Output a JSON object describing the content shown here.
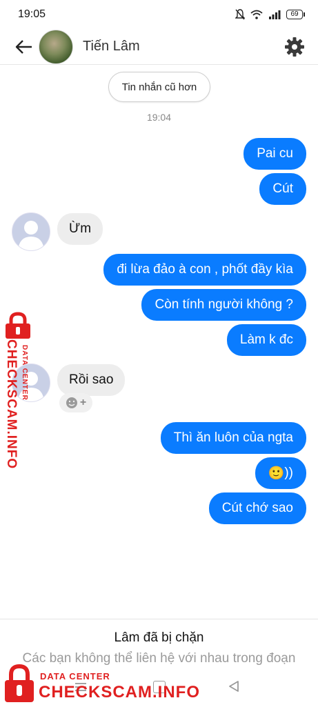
{
  "status_bar": {
    "time": "19:05",
    "battery": "69"
  },
  "header": {
    "contact_name": "Tiến Lâm"
  },
  "older_messages_label": "Tin nhắn cũ hơn",
  "timestamp": "19:04",
  "messages": [
    {
      "from": "me",
      "text": "Pai cu"
    },
    {
      "from": "me",
      "text": "Cút"
    },
    {
      "from": "them",
      "text": "Ừm"
    },
    {
      "from": "me",
      "text": "đi lừa đảo à con , phốt đầy kìa"
    },
    {
      "from": "me",
      "text": "Còn tính người không ?"
    },
    {
      "from": "me",
      "text": "Làm k đc"
    },
    {
      "from": "them",
      "text": "Rồi sao"
    },
    {
      "from": "me",
      "text": "Thì ăn luôn của ngta"
    },
    {
      "from": "me",
      "text": "))",
      "emoji": "🙂"
    },
    {
      "from": "me",
      "text": "Cút chớ sao"
    }
  ],
  "blocked": {
    "title": "Lâm đã bị chặn",
    "description": "Các bạn không thể liên hệ với nhau trong đoạn"
  },
  "watermark": {
    "small": "DATA CENTER",
    "big": "CHECKSCAM.INFO"
  },
  "colors": {
    "accent": "#0a7cff",
    "incoming": "#ededed",
    "watermark": "#e02020"
  }
}
